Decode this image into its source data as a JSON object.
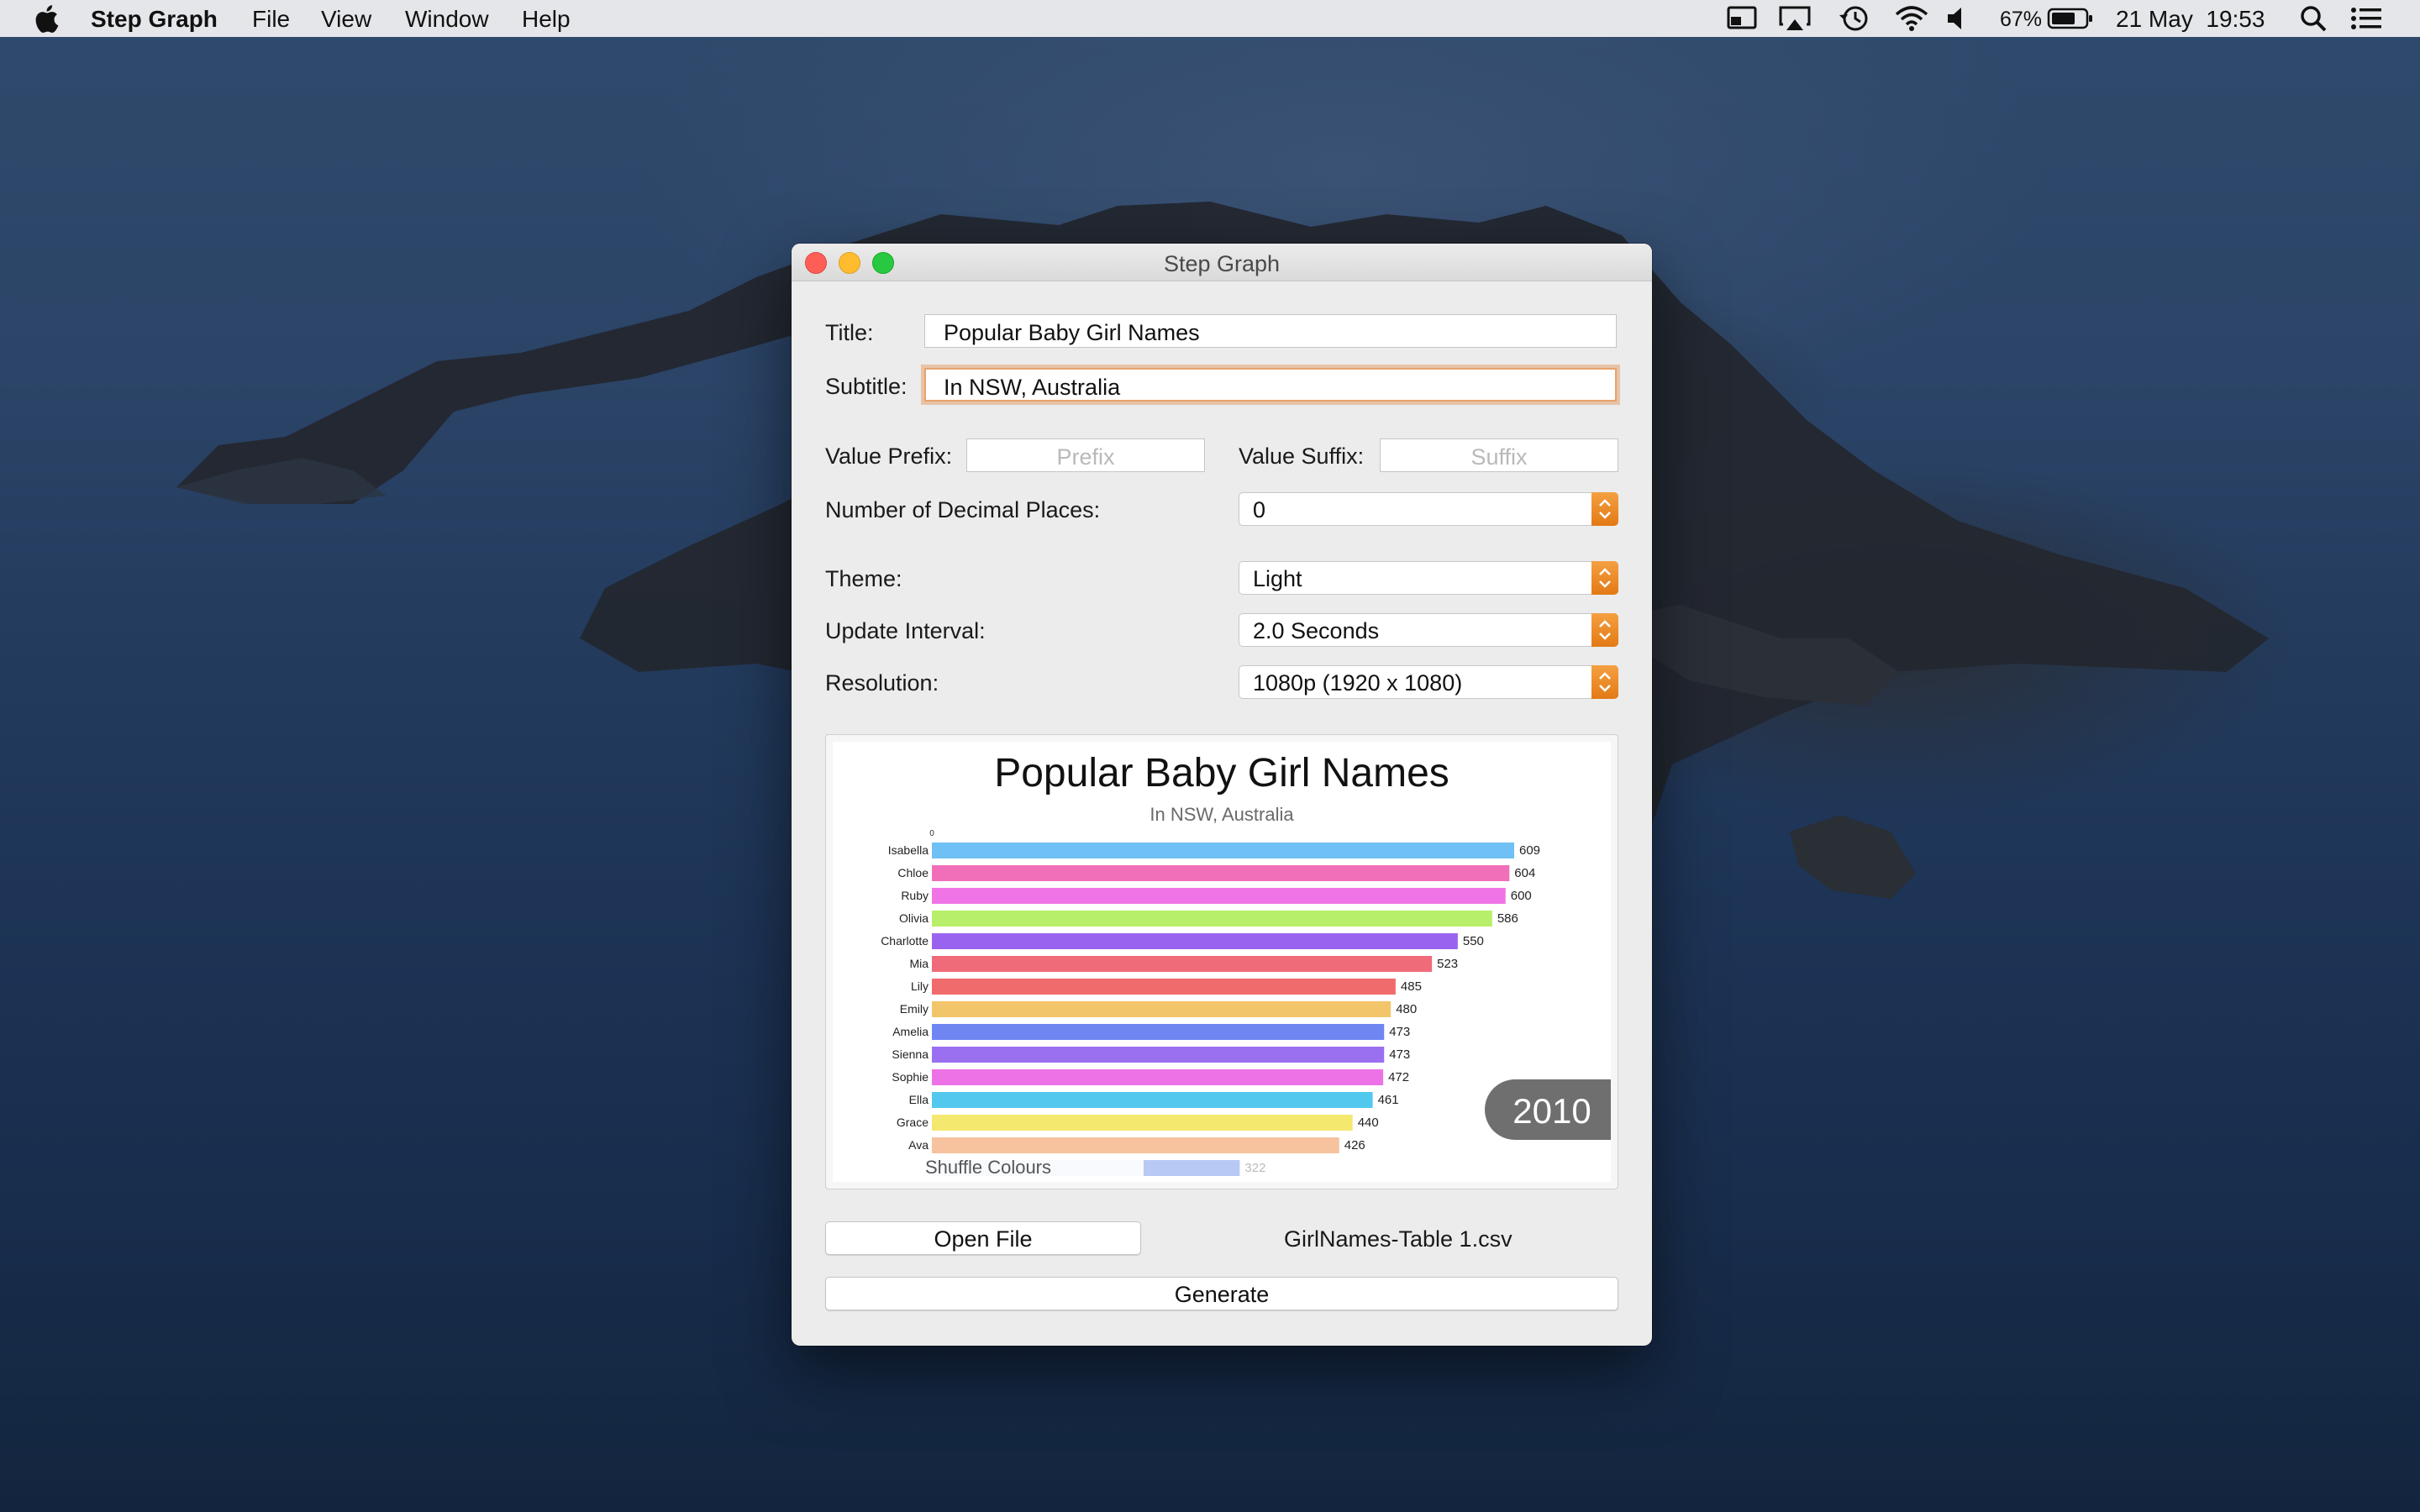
{
  "menubar": {
    "app_name": "Step Graph",
    "items": [
      "File",
      "View",
      "Window",
      "Help"
    ],
    "battery": "67%",
    "datetime": "21 May  19:53",
    "icons": [
      "apple-icon",
      "screen-mirror-icon",
      "airplay-icon",
      "time-machine-icon",
      "wifi-icon",
      "volume-icon",
      "battery-icon",
      "spotlight-icon",
      "notification-center-icon"
    ]
  },
  "window": {
    "title": "Step Graph",
    "title_label": "Title:",
    "title_value": "Popular Baby Girl Names",
    "subtitle_label": "Subtitle:",
    "subtitle_value": "In NSW, Australia",
    "value_prefix_label": "Value Prefix:",
    "value_prefix_placeholder": "Prefix",
    "value_suffix_label": "Value Suffix:",
    "value_suffix_placeholder": "Suffix",
    "decimal_label": "Number of Decimal Places:",
    "decimal_value": "0",
    "theme_label": "Theme:",
    "theme_value": "Light",
    "interval_label": "Update Interval:",
    "interval_value": "2.0 Seconds",
    "resolution_label": "Resolution:",
    "resolution_value": "1080p (1920 x 1080)",
    "shuffle_label": "Shuffle Colours",
    "open_file_label": "Open File",
    "filename": "GirlNames-Table 1.csv",
    "generate_label": "Generate"
  },
  "colors": {
    "accent": "#f39432",
    "close": "#fd5f57",
    "minimize": "#febc2e",
    "zoom": "#28c840"
  },
  "chart_data": {
    "type": "bar",
    "orientation": "horizontal",
    "title": "Popular Baby Girl Names",
    "subtitle": "In NSW, Australia",
    "year_label": "2010",
    "axis_tick": "0",
    "xlim": [
      0,
      700
    ],
    "categories": [
      "Isabella",
      "Chloe",
      "Ruby",
      "Olivia",
      "Charlotte",
      "Mia",
      "Lily",
      "Emily",
      "Amelia",
      "Sienna",
      "Sophie",
      "Ella",
      "Grace",
      "Ava"
    ],
    "values": [
      609,
      604,
      600,
      586,
      550,
      523,
      485,
      480,
      473,
      473,
      472,
      461,
      440,
      426
    ],
    "value_labels": [
      "609",
      "604",
      "600",
      "586",
      "550",
      "523",
      "485",
      "480",
      "473",
      "473",
      "472",
      "461",
      "440",
      "426"
    ],
    "bar_colors": [
      "#6fc0f4",
      "#f06fb8",
      "#f074e6",
      "#b8ef6a",
      "#9a63ef",
      "#f06b7a",
      "#f06b6b",
      "#f3c56a",
      "#6f86f2",
      "#9a6ff0",
      "#ec72e6",
      "#52c8ee",
      "#f4e86e",
      "#f7c29e"
    ],
    "partial_bar": {
      "value": 322,
      "label": "322",
      "color": "#b8c9f5"
    }
  }
}
